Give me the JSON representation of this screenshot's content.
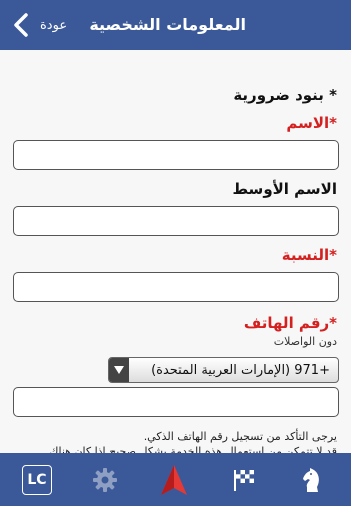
{
  "header": {
    "back_label": "عودة",
    "title": "المعلومات الشخصية"
  },
  "form": {
    "section_title": "* بنود ضرورية",
    "name_label": "*الاسم",
    "middle_name_label": "الاسم الأوسط",
    "surname_label": "*النسبة",
    "phone_label": "*رقم الهاتف",
    "phone_sublabel": "دون الواصلات",
    "country_code_selected": "+971 (الإمارات العربية المتحدة)",
    "note_line1": "يرجى التأكد من تسجيل رقم الهاتف الذكي.",
    "note_line2": "قد لا تتمكن من استعمال هذه الخدمة بشكل صحيح إذا كان هناك"
  },
  "tabbar": {
    "lc_label": "LC",
    "icons": [
      "lc-icon",
      "gear-icon",
      "compass-arrow-icon",
      "checkered-flag-icon",
      "chess-knight-icon"
    ]
  },
  "colors": {
    "header": "#3b5998",
    "required": "#d52020",
    "active_tab": "#e53935"
  }
}
